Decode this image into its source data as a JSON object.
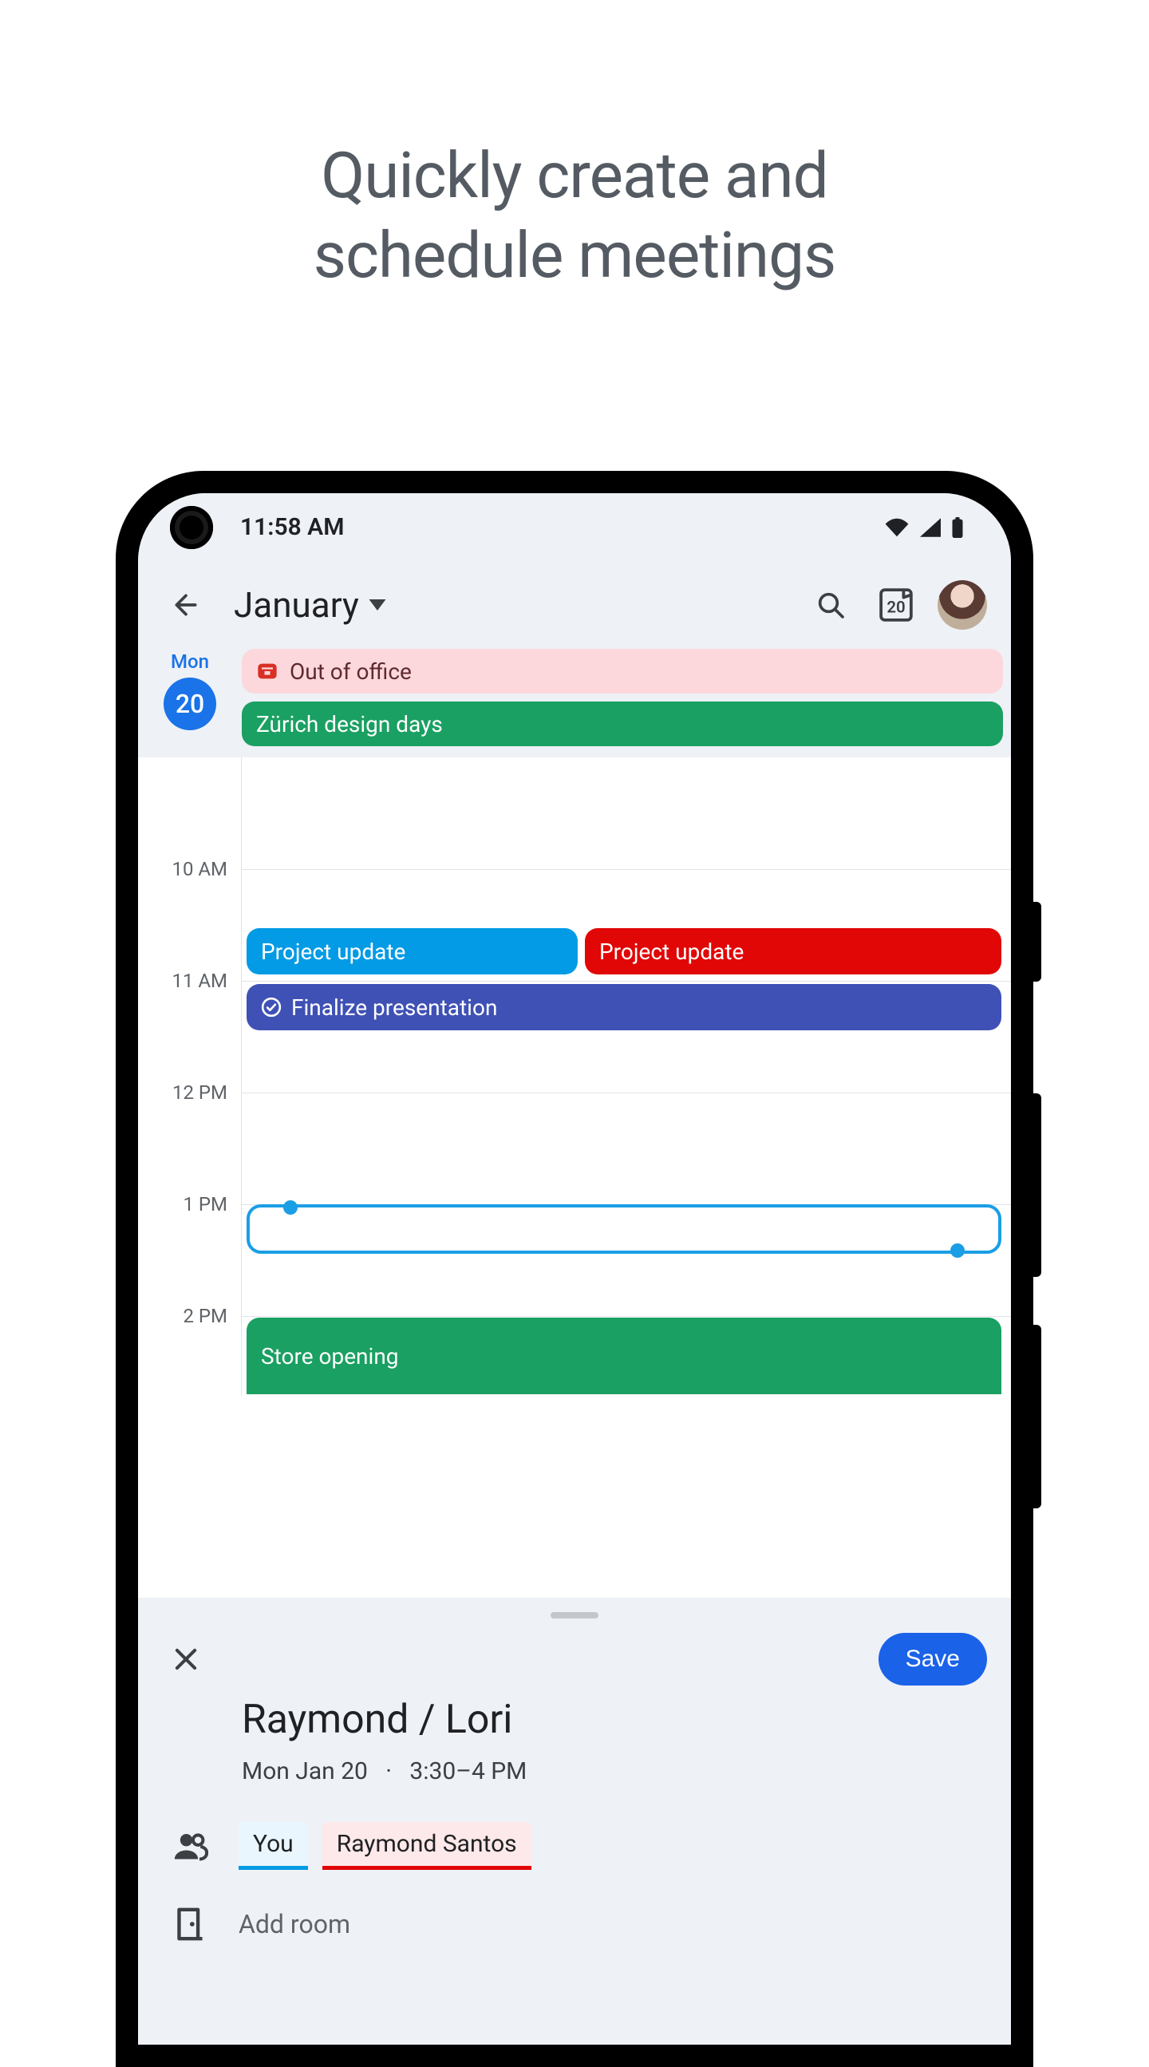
{
  "headline": {
    "line1": "Quickly create and",
    "line2": "schedule meetings"
  },
  "statusbar": {
    "time": "11:58 AM"
  },
  "appbar": {
    "month": "January",
    "today_badge": "20"
  },
  "day": {
    "dow": "Mon",
    "num": "20"
  },
  "allday": [
    {
      "label": "Out of office",
      "style": "pink",
      "icon": "briefcase"
    },
    {
      "label": "Zürich design days",
      "style": "green"
    }
  ],
  "hours": [
    "10 AM",
    "11 AM",
    "12 PM",
    "1 PM",
    "2 PM"
  ],
  "events": {
    "pu1": "Project update",
    "pu2": "Project update",
    "fin": "Finalize presentation",
    "store": "Store opening"
  },
  "sheet": {
    "save": "Save",
    "title": "Raymond / Lori",
    "date": "Mon Jan 20",
    "dot": "·",
    "time": "3:30–4 PM",
    "you": "You",
    "raymond": "Raymond Santos",
    "addroom": "Add room"
  }
}
